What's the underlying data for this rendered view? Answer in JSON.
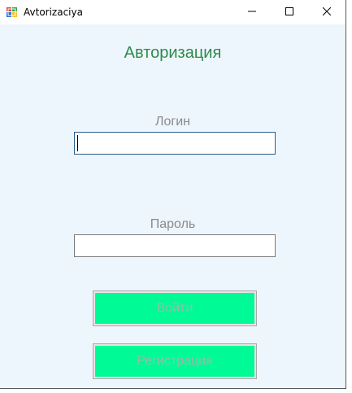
{
  "window": {
    "title": "Avtorizaciya",
    "icon": "windows-forms-app-icon"
  },
  "titlebar_controls": {
    "minimize_icon": "minimize-icon",
    "maximize_icon": "maximize-icon",
    "close_icon": "close-icon"
  },
  "form": {
    "heading": "Авторизация",
    "login_label": "Логин",
    "login_value": "",
    "password_label": "Пароль",
    "password_value": "",
    "login_button": "Войти",
    "register_button": "Регистрация"
  },
  "colors": {
    "background": "#eef6fd",
    "heading": "#2f8a4c",
    "button_fill": "#00fa96",
    "button_text": "#8fbfa8",
    "label_text": "#8a8a8a"
  }
}
